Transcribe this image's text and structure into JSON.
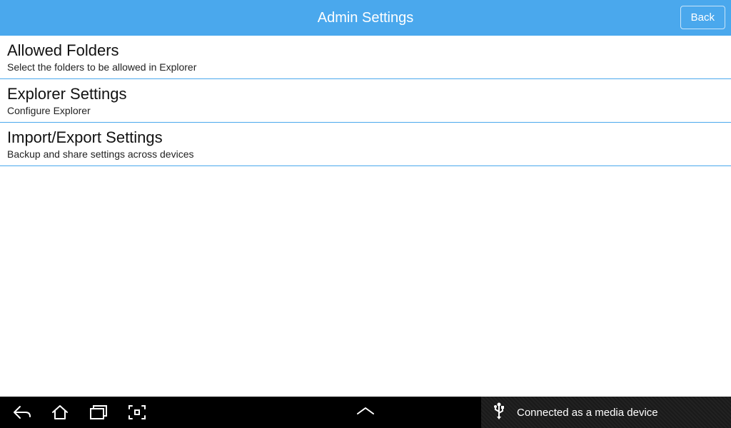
{
  "header": {
    "title": "Admin Settings",
    "back_label": "Back"
  },
  "items": [
    {
      "title": "Allowed Folders",
      "desc": "Select the folders to be allowed in Explorer"
    },
    {
      "title": "Explorer Settings",
      "desc": "Configure Explorer"
    },
    {
      "title": "Import/Export Settings",
      "desc": "Backup and share settings across devices"
    }
  ],
  "status": {
    "text": "Connected as a media device"
  }
}
